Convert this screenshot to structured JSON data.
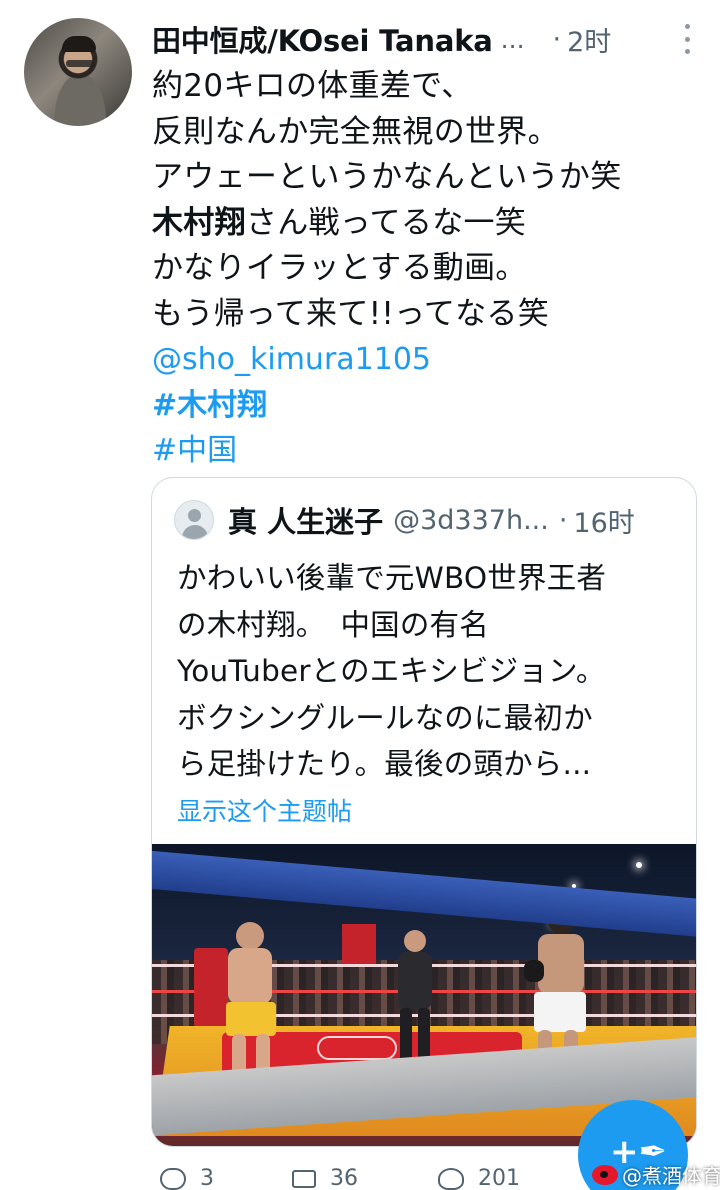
{
  "tweet": {
    "author_name": "田中恒成/KOsei Tanaka",
    "name_ellipsis": "...",
    "separator": "·",
    "time": "2时",
    "lines": [
      "約20キロの体重差で、",
      "反則なんか完全無視の世界。",
      "アウェーというかなんというか笑"
    ],
    "bold_name": "木村翔",
    "line_after_bold": "さん戦ってるな一笑",
    "lines_2": [
      "かなりイラッとする動画。",
      "もう帰って来て!!ってなる笑"
    ],
    "mention": "@sho_kimura1105",
    "hashtags": [
      "#木村翔",
      "#中国"
    ]
  },
  "quote": {
    "name": "真 人生迷子",
    "handle": "@3d337h...",
    "separator": "·",
    "time": "16时",
    "lines": [
      "かわいい後輩で元WBO世界王者",
      "の木村翔。　中国の有名",
      "YouTuberとのエキシビジョン。",
      "ボクシングルールなのに最初か",
      "ら足掛けたり。最後の頭から..."
    ],
    "show_thread": "显示这个主题帖"
  },
  "actions": {
    "reply_count": "3",
    "retweet_count": "36",
    "like_count": "201"
  },
  "fab": {
    "icon": "+✒"
  },
  "watermark": {
    "text": "@煮酒体育"
  },
  "colors": {
    "accent": "#1d9bf0",
    "text": "#0f1419",
    "secondary": "#536471",
    "border": "#cfd9de"
  },
  "icons": [
    "more-icon",
    "reply-icon",
    "retweet-icon",
    "like-icon",
    "compose-icon",
    "weibo-icon"
  ]
}
